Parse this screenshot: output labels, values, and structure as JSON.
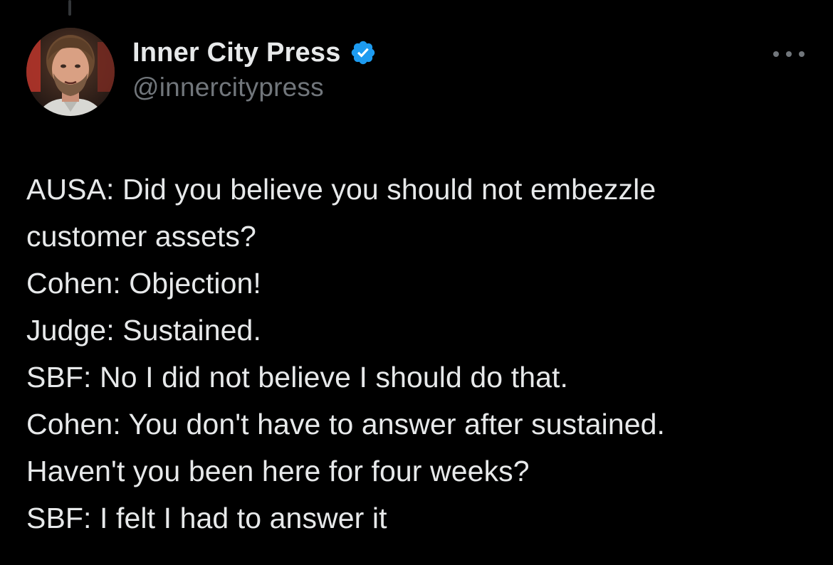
{
  "tweet": {
    "author": {
      "display_name": "Inner City Press",
      "handle": "@innercitypress",
      "verified": true,
      "avatar_icon": "avatar-photo",
      "verified_icon": "verified-badge-icon",
      "verified_color": "#1d9bf0"
    },
    "more_icon": "more-options-icon",
    "lines": [
      "AUSA: Did you believe you should not embezzle",
      "customer assets?",
      "Cohen: Objection!",
      "Judge: Sustained.",
      "SBF: No I did not believe I should do that.",
      "Cohen: You don't have to answer after sustained.",
      "Haven't you been here for four weeks?",
      "SBF: I felt I had to answer it"
    ]
  },
  "theme": {
    "background": "#000000",
    "text": "#e7e9ea",
    "secondary_text": "#71767b"
  }
}
